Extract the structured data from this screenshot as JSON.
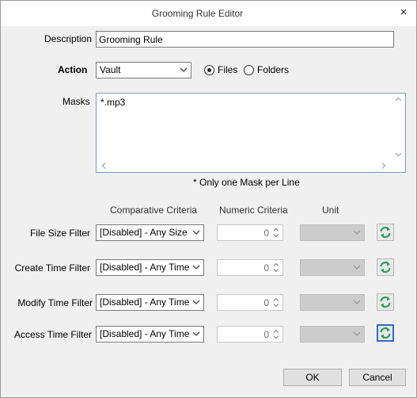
{
  "window": {
    "title": "Grooming Rule Editor",
    "close_glyph": "×"
  },
  "description": {
    "label": "Description",
    "value": "Grooming Rule"
  },
  "action": {
    "label": "Action",
    "selected": "Vault",
    "radio_files": "Files",
    "radio_folders": "Folders",
    "selected_target": "Files"
  },
  "masks": {
    "label": "Masks",
    "value": "*.mp3",
    "note": "* Only one Mask per Line"
  },
  "columns": {
    "comparative": "Comparative Criteria",
    "numeric": "Numeric Criteria",
    "unit": "Unit"
  },
  "filters": [
    {
      "label": "File Size Filter",
      "comparative": "[Disabled] - Any Size",
      "numeric": "0",
      "unit": ""
    },
    {
      "label": "Create Time Filter",
      "comparative": "[Disabled] - Any Time",
      "numeric": "0",
      "unit": ""
    },
    {
      "label": "Modify Time Filter",
      "comparative": "[Disabled] - Any Time",
      "numeric": "0",
      "unit": ""
    },
    {
      "label": "Access Time Filter",
      "comparative": "[Disabled] - Any Time",
      "numeric": "0",
      "unit": ""
    }
  ],
  "buttons": {
    "ok": "OK",
    "cancel": "Cancel"
  },
  "icons": {
    "refresh": "refresh-icon",
    "close": "close-icon",
    "dropdown": "chevron-down-icon"
  },
  "colors": {
    "refresh_green": "#2f9e5b",
    "focus_blue": "#2d6cc8",
    "masks_border": "#7a9cc8"
  }
}
